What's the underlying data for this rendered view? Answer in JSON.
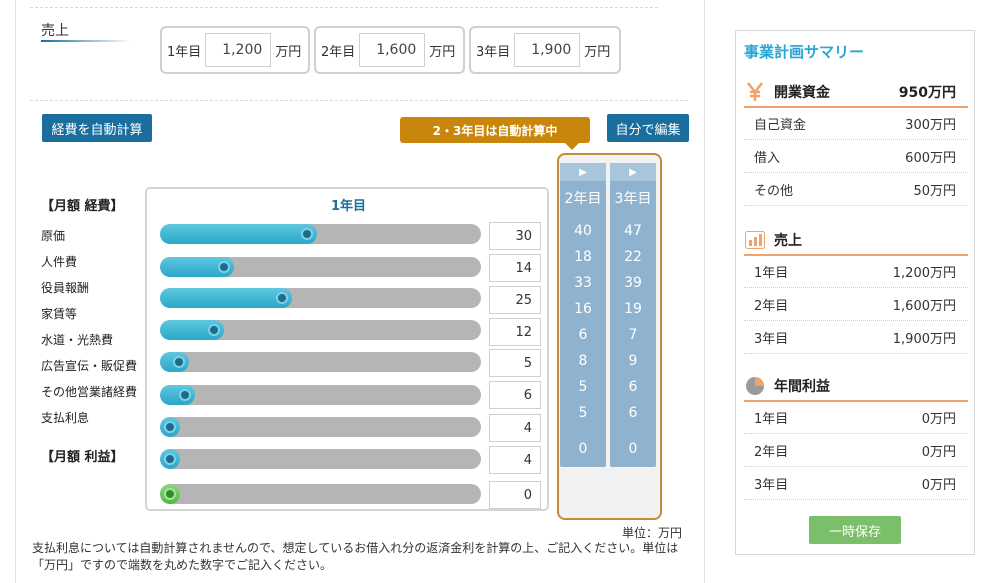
{
  "sales": {
    "label": "売上",
    "years": [
      {
        "label": "1年目",
        "value": "1,200",
        "unit": "万円"
      },
      {
        "label": "2年目",
        "value": "1,600",
        "unit": "万円"
      },
      {
        "label": "3年目",
        "value": "1,900",
        "unit": "万円"
      }
    ]
  },
  "buttons": {
    "auto_calc": "経費を自動計算",
    "self_edit": "自分で編集",
    "save": "一時保存"
  },
  "tooltip": "2・3年目は自動計算中",
  "panel_title": "1年目",
  "auto_columns": [
    {
      "arrow": "▶",
      "year": "2年目",
      "values": [
        "40",
        "18",
        "33",
        "16",
        "6",
        "8",
        "5",
        "5",
        "0"
      ]
    },
    {
      "arrow": "▶",
      "year": "3年目",
      "values": [
        "47",
        "22",
        "39",
        "19",
        "7",
        "9",
        "6",
        "6",
        "0"
      ]
    }
  ],
  "expenses_head": "【月額 経費】",
  "profit_head": "【月額 利益】",
  "expenses": [
    {
      "label": "原価",
      "value": "30",
      "fill": 0.49
    },
    {
      "label": "人件費",
      "value": "14",
      "fill": 0.23
    },
    {
      "label": "役員報酬",
      "value": "25",
      "fill": 0.41
    },
    {
      "label": "家賃等",
      "value": "12",
      "fill": 0.2
    },
    {
      "label": "水道・光熱費",
      "value": "5",
      "fill": 0.09
    },
    {
      "label": "広告宣伝・販促費",
      "value": "6",
      "fill": 0.11
    },
    {
      "label": "その他営業諸経費",
      "value": "4",
      "fill": 0.06
    },
    {
      "label": "支払利息",
      "value": "4",
      "fill": 0.06
    }
  ],
  "profit": {
    "value": "0",
    "fill": 0.05
  },
  "unit_note": "単位：万円",
  "note": "支払利息については自動計算されませんので、想定しているお借入れ分の返済金利を計算の上、ご記入ください。単位は「万円」ですので端数を丸めた数字でご記入ください。",
  "summary": {
    "title": "事業計画サマリー",
    "capital": {
      "head": "開業資金",
      "total": "950万円",
      "icon": "yen-icon",
      "rows": [
        {
          "label": "自己資金",
          "value": "300万円"
        },
        {
          "label": "借入",
          "value": "600万円"
        },
        {
          "label": "その他",
          "value": "50万円"
        }
      ]
    },
    "sales": {
      "head": "売上",
      "icon": "bar-chart-icon",
      "rows": [
        {
          "label": "1年目",
          "value": "1,200万円"
        },
        {
          "label": "2年目",
          "value": "1,600万円"
        },
        {
          "label": "3年目",
          "value": "1,900万円"
        }
      ]
    },
    "profit": {
      "head": "年間利益",
      "icon": "pie-chart-icon",
      "rows": [
        {
          "label": "1年目",
          "value": "0万円"
        },
        {
          "label": "2年目",
          "value": "0万円"
        },
        {
          "label": "3年目",
          "value": "0万円"
        }
      ]
    }
  },
  "colors": {
    "accent": "#1a6e9e",
    "tooltip": "#c8860d",
    "summary_title": "#29a4d4",
    "section_rule": "#f0a36a",
    "save": "#7bbf6a"
  }
}
